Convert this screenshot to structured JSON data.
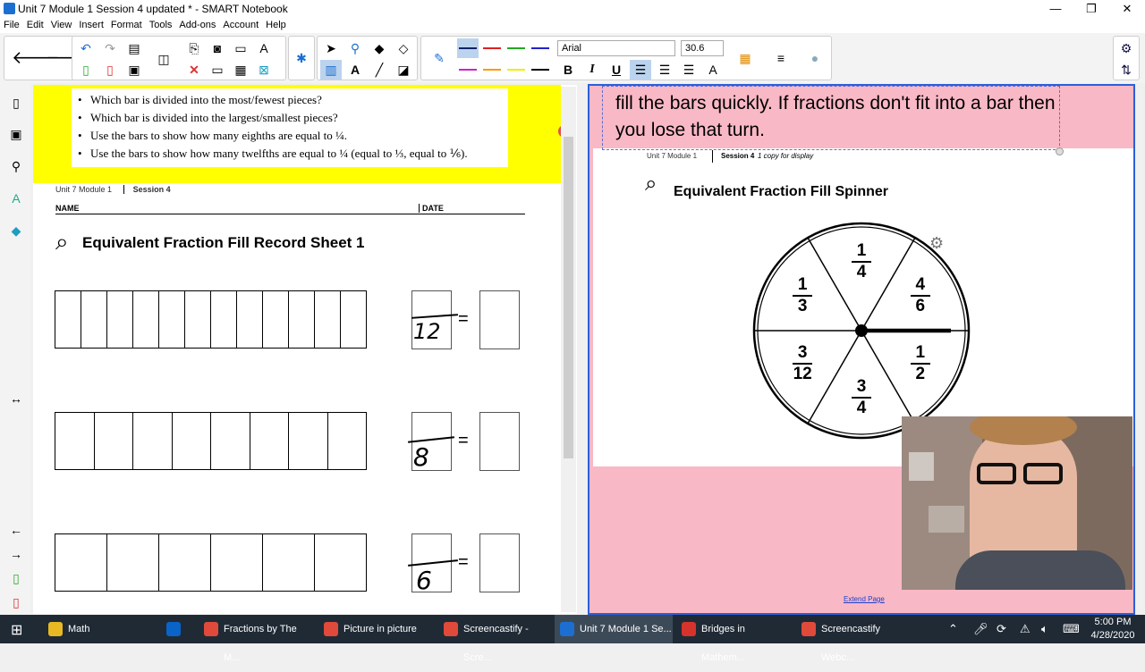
{
  "window": {
    "title": "Unit 7 Module 1 Session 4 updated * - SMART Notebook",
    "minimize": "—",
    "maximize": "❐",
    "close": "✕"
  },
  "menu": [
    "File",
    "Edit",
    "View",
    "Insert",
    "Format",
    "Tools",
    "Add-ons",
    "Account",
    "Help"
  ],
  "toolbar": {
    "font_name": "Arial",
    "font_size": "30.6",
    "bold": "B",
    "italic": "I",
    "underline": "U"
  },
  "left_page": {
    "questions": [
      "Which bar is divided into the most/fewest pieces?",
      "Which bar is divided into the largest/smallest pieces?",
      "Use the bars to show how many eighths are equal to ¼.",
      "Use the bars to show how many twelfths are equal to ¼ (equal to ⅓, equal to ⅙)."
    ],
    "header_unit": "Unit 7  Module 1",
    "header_session": "Session 4",
    "name_label": "NAME",
    "date_label": "DATE",
    "title": "Equivalent Fraction Fill Record Sheet 1",
    "bars": [
      {
        "pieces": 12,
        "denominator": "12"
      },
      {
        "pieces": 8,
        "denominator": "8"
      },
      {
        "pieces": 6,
        "denominator": "6"
      }
    ],
    "equals": "="
  },
  "right_page": {
    "text": "fill the bars quickly.  If fractions don't fit into a bar then you lose that turn.",
    "header_unit": "Unit 7  Module 1",
    "header_session": "Session 4",
    "header_note": "1 copy for display",
    "title": "Equivalent Fraction Fill Spinner",
    "spinner": [
      {
        "num": "1",
        "den": "4"
      },
      {
        "num": "4",
        "den": "6"
      },
      {
        "num": "1",
        "den": "2"
      },
      {
        "num": "3",
        "den": "4"
      },
      {
        "num": "3",
        "den": "12"
      },
      {
        "num": "1",
        "den": "3"
      }
    ],
    "extend_link": "Extend Page"
  },
  "taskbar": {
    "apps": [
      {
        "label": "Math",
        "color": "#e8b923"
      },
      {
        "label": "",
        "color": "#0a64c8"
      },
      {
        "label": "Fractions by The M...",
        "color": "#e04a3a"
      },
      {
        "label": "Picture in picture",
        "color": "#e04a3a"
      },
      {
        "label": "Screencastify - Scre...",
        "color": "#e04a3a"
      },
      {
        "label": "Unit 7 Module 1 Se...",
        "color": "#1c6fd1"
      },
      {
        "label": "Bridges in Mathem...",
        "color": "#d6332c"
      },
      {
        "label": "Screencastify Webc...",
        "color": "#e04a3a"
      }
    ],
    "time": "5:00 PM",
    "date": "4/28/2020"
  }
}
